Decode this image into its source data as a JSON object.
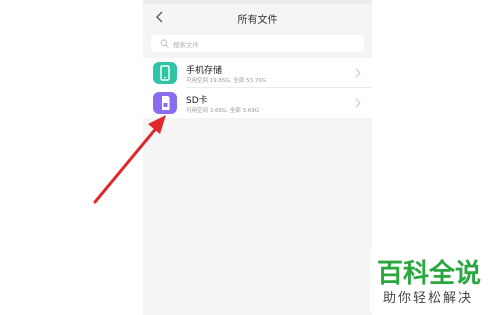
{
  "status_bar": {
    "left_text": "",
    "center_text": ""
  },
  "header": {
    "title": "所有文件",
    "back_icon": "chevron-left-icon"
  },
  "search": {
    "placeholder": "搜索文件",
    "icon": "search-icon"
  },
  "storage_list": [
    {
      "name": "手机存储",
      "detail": "可用空间 19.85G, 全部 53.70G",
      "icon": "phone-icon",
      "icon_color": "#2ec4a4"
    },
    {
      "name": "SD卡",
      "detail": "可用空间 3.66G, 全部 3.69G",
      "icon": "sd-card-icon",
      "icon_color": "#8a6cf0"
    }
  ],
  "annotation": {
    "arrow_color": "#e0282a"
  },
  "watermark": {
    "title": "百科全说",
    "subtitle": "助你轻松解决",
    "color": "#2aa73f"
  }
}
